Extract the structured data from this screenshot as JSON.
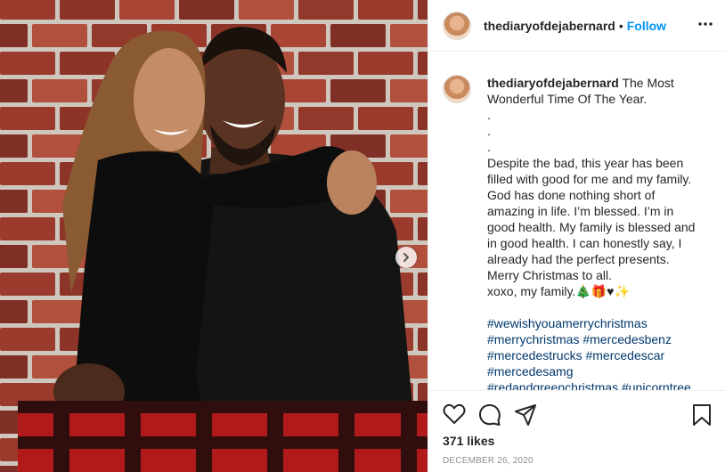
{
  "post": {
    "image_alt": "Couple hugging in front of a brick wall",
    "next_arrow_icon": "chevron-right-icon"
  },
  "header": {
    "username": "thediaryofdejabernard",
    "separator": "•",
    "follow_label": "Follow",
    "more_icon": "more-horizontal-icon"
  },
  "caption": {
    "username": "thediaryofdejabernard",
    "title": "The Most Wonderful Time Of The Year.",
    "dots": [
      ".",
      ".",
      "."
    ],
    "body": "Despite the bad, this year has been filled with good for me and my family. God has done nothing short of amazing in life. I’m blessed. I’m in good health. My family is blessed and in good health. I can honestly say, I already had the perfect presents. Merry Christmas to all.",
    "signoff": "xoxo, my family.🎄🎁♥✨",
    "hashtags": [
      "#wewishyouamerrychristmas",
      "#merrychristmas",
      "#mercedesbenz",
      "#mercedestrucks",
      "#mercedescar",
      "#mercedesamg",
      "#redandgreenchristmas",
      "#unicorntree"
    ]
  },
  "actions": {
    "like_icon": "heart-icon",
    "comment_icon": "comment-icon",
    "share_icon": "paper-plane-icon",
    "save_icon": "bookmark-icon",
    "likes_text": "371 likes",
    "date_text": "DECEMBER 26, 2020"
  },
  "colors": {
    "link_blue": "#0095f6",
    "hashtag_blue": "#00376b",
    "muted": "#8e8e8e",
    "border": "#efefef"
  }
}
